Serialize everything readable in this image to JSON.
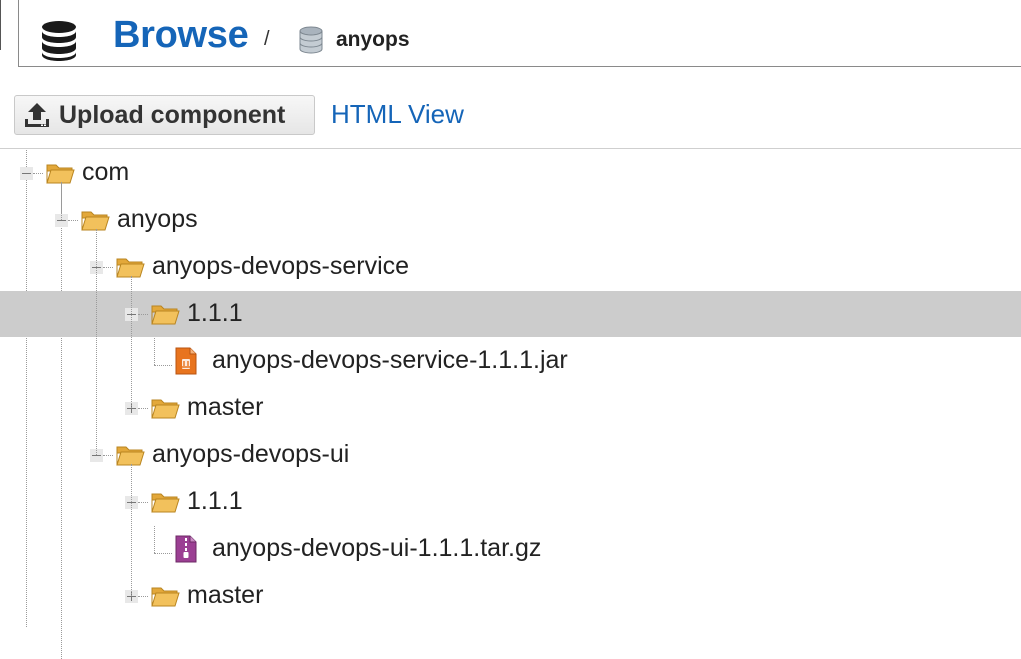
{
  "header": {
    "title": "Browse",
    "separator": "/",
    "repository": "anyops",
    "icon": "database-icon",
    "title_color": "#1565b8"
  },
  "toolbar": {
    "upload_label": "Upload component",
    "upload_icon": "upload-icon",
    "html_view_label": "HTML View"
  },
  "tree": [
    {
      "label": "com",
      "depth": 0,
      "type": "folder",
      "expanded": true
    },
    {
      "label": "anyops",
      "depth": 1,
      "type": "folder",
      "expanded": true
    },
    {
      "label": "anyops-devops-service",
      "depth": 2,
      "type": "folder",
      "expanded": true
    },
    {
      "label": "1.1.1",
      "depth": 3,
      "type": "folder",
      "expanded": true,
      "selected": true
    },
    {
      "label": "anyops-devops-service-1.1.1.jar",
      "depth": 4,
      "type": "jar-file"
    },
    {
      "label": "master",
      "depth": 3,
      "type": "folder",
      "expanded": false
    },
    {
      "label": "anyops-devops-ui",
      "depth": 2,
      "type": "folder",
      "expanded": true
    },
    {
      "label": "1.1.1",
      "depth": 3,
      "type": "folder",
      "expanded": true
    },
    {
      "label": "anyops-devops-ui-1.1.1.tar.gz",
      "depth": 4,
      "type": "archive-file"
    },
    {
      "label": "master",
      "depth": 3,
      "type": "folder",
      "expanded": false
    }
  ],
  "colors": {
    "selected_row": "#cccccc",
    "link": "#1565b8",
    "folder": "#f2c15c",
    "jar": "#e8741e",
    "archive": "#9b3f93"
  }
}
